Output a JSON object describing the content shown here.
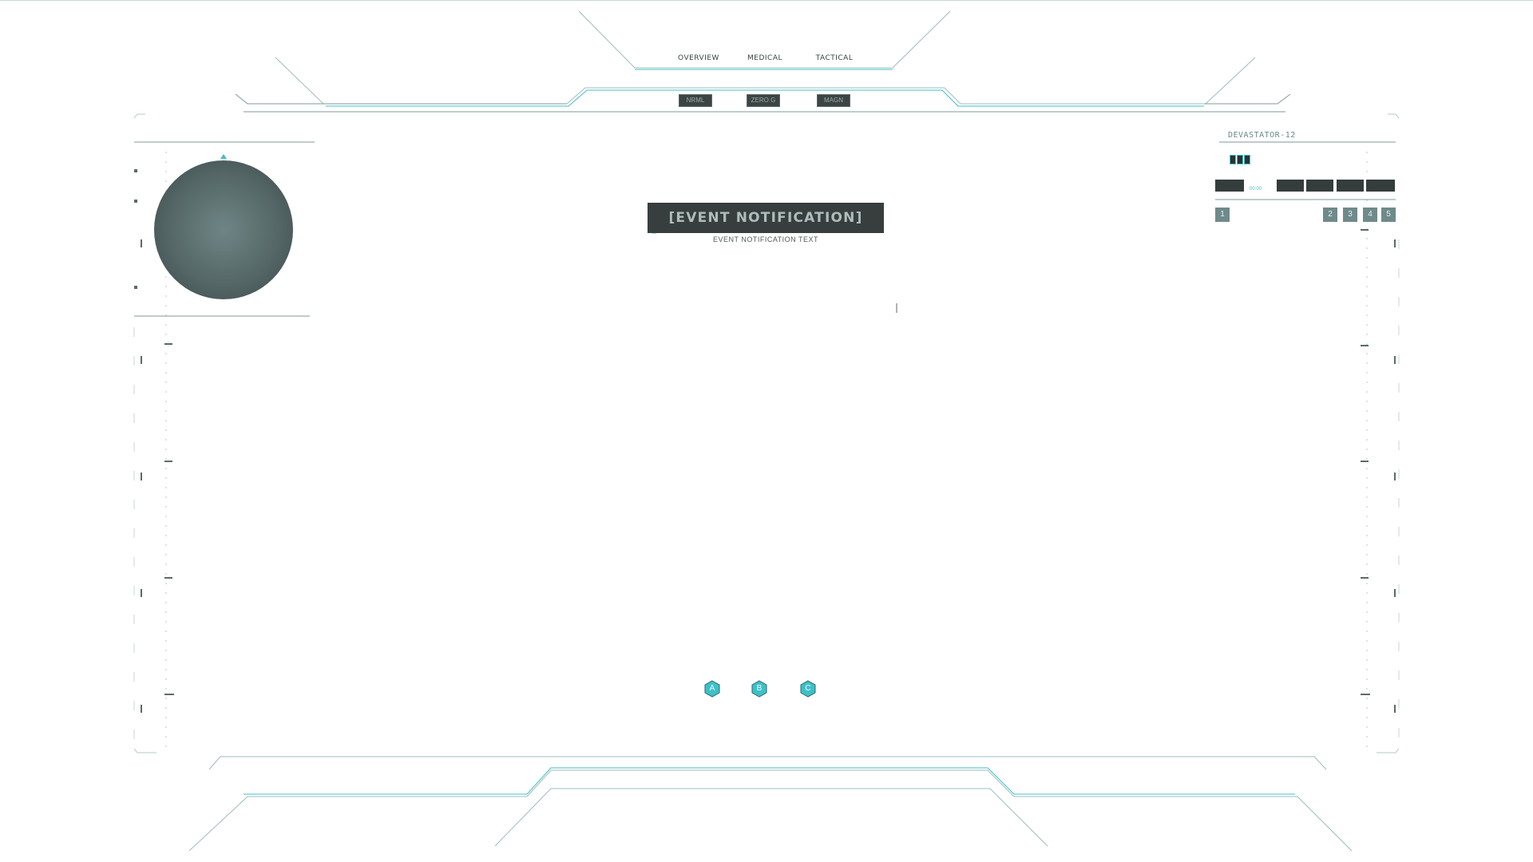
{
  "hud": {
    "mode_tabs": [
      "OVERVIEW",
      "MEDICAL",
      "TACTICAL"
    ],
    "gravity_modes": [
      "NRML",
      "ZERO G",
      "MAGN"
    ]
  },
  "event": {
    "title": "[EVENT NOTIFICATION]",
    "subtitle": "EVENT NOTIFICATION TEXT"
  },
  "status": {
    "label": "DEVASTATOR-12",
    "hp_value": "00:00"
  },
  "slots": [
    "1",
    "2",
    "3",
    "4",
    "5"
  ],
  "abilities": [
    "A",
    "B",
    "C"
  ],
  "colors": {
    "accent": "#3ec0c8",
    "line": "#8fb5b5",
    "panel": "#383e3e"
  }
}
